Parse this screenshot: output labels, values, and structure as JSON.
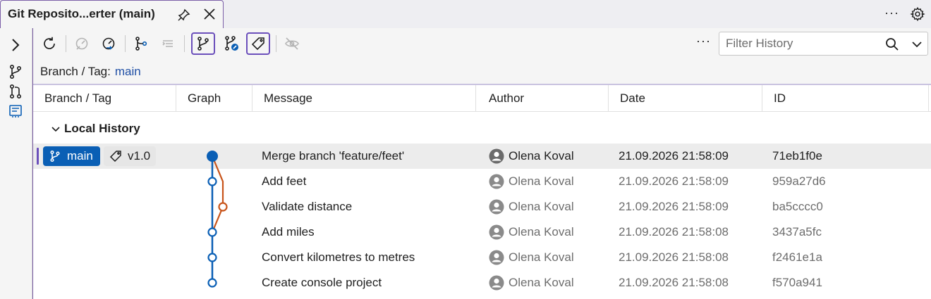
{
  "tab": {
    "title": "Git Reposito...erter (main)"
  },
  "toolbar": {
    "more": "···",
    "filter_placeholder": "Filter History"
  },
  "branch_line": {
    "label": "Branch / Tag:",
    "value": "main"
  },
  "columns": [
    "Branch / Tag",
    "Graph",
    "Message",
    "Author",
    "Date",
    "ID"
  ],
  "group": {
    "label": "Local History"
  },
  "branch_pill": {
    "label": "main"
  },
  "tag_pill": {
    "label": "v1.0"
  },
  "commits": [
    {
      "message": "Merge branch 'feature/feet'",
      "author": "Olena Koval",
      "date": "21.09.2026 21:58:09",
      "id": "71eb1f0e"
    },
    {
      "message": "Add feet",
      "author": "Olena Koval",
      "date": "21.09.2026 21:58:09",
      "id": "959a27d6"
    },
    {
      "message": "Validate distance",
      "author": "Olena Koval",
      "date": "21.09.2026 21:58:09",
      "id": "ba5cccc0"
    },
    {
      "message": "Add miles",
      "author": "Olena Koval",
      "date": "21.09.2026 21:58:08",
      "id": "3437a5fc"
    },
    {
      "message": "Convert kilometres to metres",
      "author": "Olena Koval",
      "date": "21.09.2026 21:58:08",
      "id": "f2461e1a"
    },
    {
      "message": "Create console project",
      "author": "Olena Koval",
      "date": "21.09.2026 21:58:08",
      "id": "f570a941"
    }
  ],
  "colors": {
    "accent": "#6b4fbb",
    "main_branch": "#0a5fb5",
    "feature_branch": "#c8541a"
  }
}
